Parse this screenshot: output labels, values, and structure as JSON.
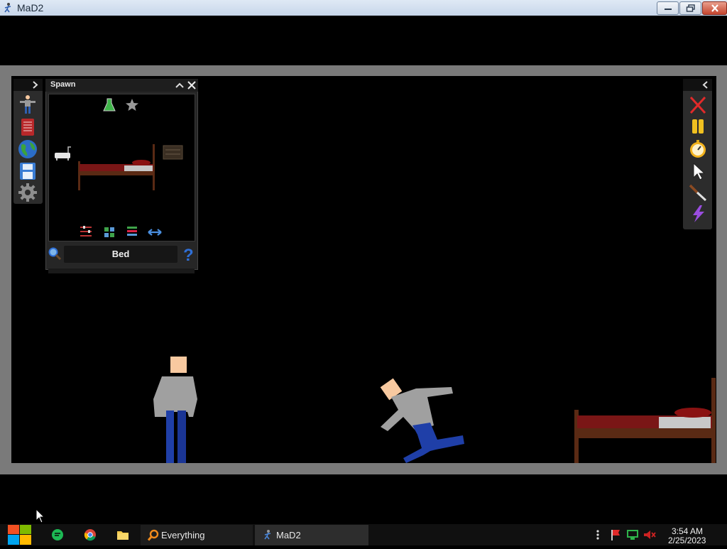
{
  "window": {
    "title": "MaD2"
  },
  "spawn_panel": {
    "title": "Spawn",
    "search_value": "Bed",
    "selected_item": "bed"
  },
  "left_toolbar": {
    "tools": [
      "ragdoll-icon",
      "book-icon",
      "globe-icon",
      "save-icon",
      "gear-icon"
    ]
  },
  "right_toolbar": {
    "tools": [
      "close-x-icon",
      "pause-icon",
      "stopwatch-icon",
      "cursor-icon",
      "knife-icon",
      "lightning-icon"
    ]
  },
  "taskbar": {
    "items": [
      {
        "label": "Everything"
      },
      {
        "label": "MaD2"
      }
    ],
    "clock_time": "3:54 AM",
    "clock_date": "2/25/2023"
  },
  "colors": {
    "accent_blue": "#2f6fd6",
    "panel_bg": "#262626",
    "frame_gray": "#7a7a7a",
    "bed_frame": "#5a2a14",
    "bed_blanket": "#7a1616",
    "ragdoll_shirt": "#a0a0a0",
    "ragdoll_pants": "#1f3fa8",
    "ragdoll_skin": "#f8c9a0"
  }
}
